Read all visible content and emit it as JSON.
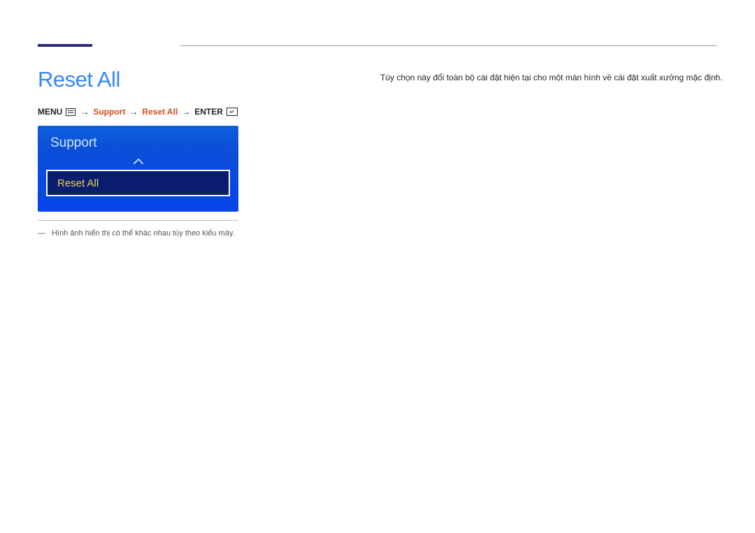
{
  "page": {
    "title": "Reset All"
  },
  "breadcrumb": {
    "menu_label": "MENU",
    "step1": "Support",
    "step2": "Reset All",
    "enter_label": "ENTER"
  },
  "panel": {
    "header": "Support",
    "selected_item": "Reset All"
  },
  "footnote": {
    "text": "Hình ảnh hiển thị có thể khác nhau tùy theo kiểu máy."
  },
  "description": {
    "text": "Tùy chọn này đổi toàn bộ cài đặt hiện tại cho một màn hình về cài đặt xuất xưởng mặc định."
  }
}
